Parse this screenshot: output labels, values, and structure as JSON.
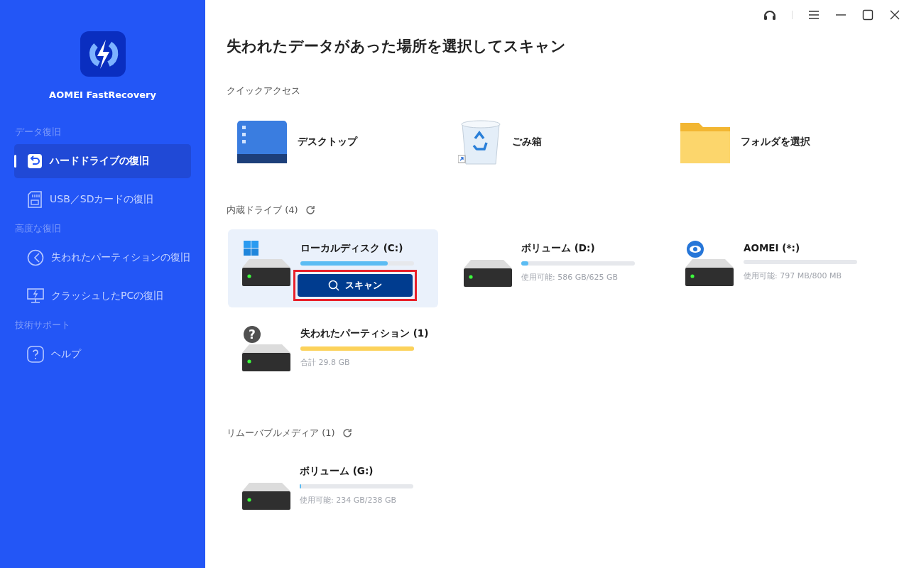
{
  "app": {
    "name": "AOMEI FastRecovery"
  },
  "sidebar": {
    "groups": [
      {
        "heading": "データ復旧",
        "items": [
          {
            "label": "ハードドライブの復旧",
            "kind": "restore",
            "selected": true
          },
          {
            "label": "USB／SDカードの復旧",
            "kind": "sdcard",
            "selected": false
          }
        ]
      },
      {
        "heading": "高度な復旧",
        "items": [
          {
            "label": "失われたパーティションの復旧",
            "kind": "partition",
            "selected": false
          },
          {
            "label": "クラッシュしたPCの復旧",
            "kind": "monitor",
            "selected": false
          }
        ]
      },
      {
        "heading": "技術サポート",
        "items": [
          {
            "label": "ヘルプ",
            "kind": "help",
            "selected": false
          }
        ]
      }
    ]
  },
  "page_title": "失われたデータがあった場所を選択してスキャン",
  "quick_access": {
    "heading": "クイックアクセス",
    "items": [
      {
        "label": "デスクトップ",
        "kind": "desktop"
      },
      {
        "label": "ごみ箱",
        "kind": "recycle"
      },
      {
        "label": "フォルダを選択",
        "kind": "folder"
      }
    ]
  },
  "sections": [
    {
      "heading": "内蔵ドライブ (4)",
      "drives": [
        {
          "name": "ローカルディスク (C:)",
          "kind": "windows",
          "level": 0.77,
          "color": "#5bbcf3",
          "selected": true,
          "scan_button": {
            "label": "スキャン",
            "highlighted": true
          }
        },
        {
          "name": "ボリューム (D:)",
          "kind": "plain",
          "level": 0.06,
          "color": "#5bbcf3",
          "selected": false,
          "info": "使用可能: 586 GB/625 GB"
        },
        {
          "name": "AOMEI (*:)",
          "kind": "eye",
          "selected": false,
          "info": "使用可能: 797 MB/800 MB"
        },
        {
          "name": "失われたパーティション (1)",
          "kind": "unknown",
          "badge_text": "?",
          "level": 1.0,
          "color": "#fcd25a",
          "selected": false,
          "info": "合計 29.8 GB"
        }
      ]
    },
    {
      "heading": "リムーバブルメディア (1)",
      "drives": [
        {
          "name": "ボリューム (G:)",
          "kind": "plain",
          "level": 0.01,
          "color": "#5bbcf3",
          "selected": false,
          "info": "使用可能: 234 GB/238 GB"
        }
      ]
    }
  ]
}
